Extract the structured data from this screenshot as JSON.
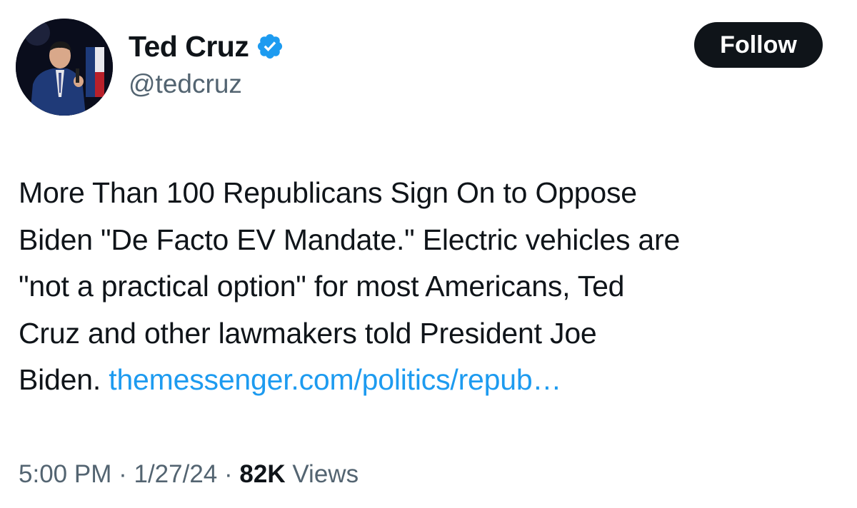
{
  "author": {
    "display_name": "Ted Cruz",
    "handle": "@tedcruz",
    "verified": true,
    "avatar": "profile-photo"
  },
  "follow_button": {
    "label": "Follow"
  },
  "tweet": {
    "text_lines": [
      "More Than 100 Republicans Sign On to Oppose",
      "Biden \"De Facto EV Mandate.\" Electric vehicles are",
      "\"not a practical option\" for most Americans, Ted",
      "Cruz and other lawmakers told President Joe",
      "Biden."
    ],
    "link_text": "themessenger.com/politics/repub…"
  },
  "meta": {
    "time": "5:00 PM",
    "separator": "·",
    "date": "1/27/24",
    "views_count": "82K",
    "views_label": "Views"
  },
  "colors": {
    "text": "#0f1419",
    "secondary": "#536471",
    "link": "#1d9bf0",
    "follow_bg": "#0f1419",
    "verified_badge": "#1d9bf0"
  }
}
